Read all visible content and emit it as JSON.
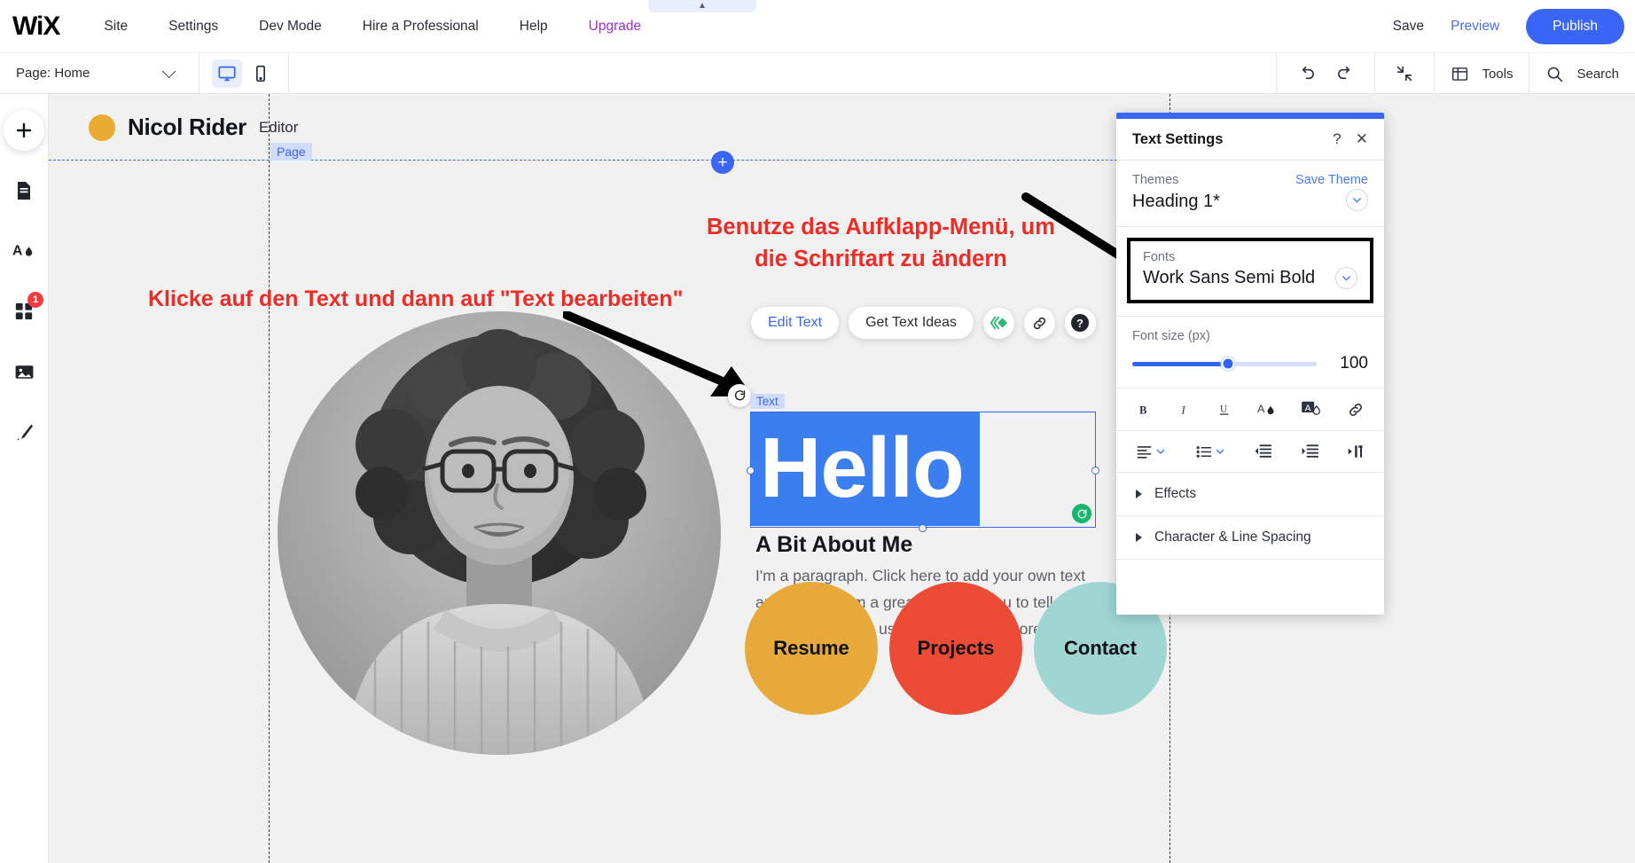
{
  "topbar": {
    "logo": "WiX",
    "nav": [
      {
        "label": "Site"
      },
      {
        "label": "Settings"
      },
      {
        "label": "Dev Mode"
      },
      {
        "label": "Hire a Professional"
      },
      {
        "label": "Help"
      },
      {
        "label": "Upgrade"
      }
    ],
    "save_label": "Save",
    "preview_label": "Preview",
    "publish_label": "Publish"
  },
  "secondbar": {
    "page_label": "Page: Home",
    "desktop_icon": "desktop-icon",
    "mobile_icon": "mobile-icon",
    "undo_icon": "undo-icon",
    "redo_icon": "redo-icon",
    "zoomout_icon": "zoom-out-icon",
    "tools_label": "Tools",
    "search_label": "Search"
  },
  "sidebar": {
    "items": [
      {
        "icon": "plus-icon",
        "name": "add-elements"
      },
      {
        "icon": "page-icon",
        "name": "pages"
      },
      {
        "icon": "theme-icon",
        "name": "site-design"
      },
      {
        "icon": "apps-icon",
        "name": "apps",
        "badge": "1"
      },
      {
        "icon": "media-icon",
        "name": "media"
      },
      {
        "icon": "pen-icon",
        "name": "blog"
      }
    ]
  },
  "canvas": {
    "brand_name": "Nicol Rider",
    "brand_sub": "Editor",
    "page_tag": "Page",
    "text_tag": "Text",
    "hello_text": "Hello",
    "about_title": "A Bit About Me",
    "about_body": "I'm a paragraph. Click here to add your own text and edit me. I’m a great place for you to tell a story and let your users know a little more about you.",
    "circles": [
      {
        "label": "Resume",
        "color": "#e6a93a"
      },
      {
        "label": "Projects",
        "color": "#ec4b36"
      },
      {
        "label": "Contact",
        "color": "#9fd6d4"
      }
    ],
    "edit_toolbar": {
      "edit_text": "Edit Text",
      "get_text_ideas": "Get Text Ideas",
      "animation_icon": "animation-icon",
      "link_icon": "link-icon",
      "help_icon": "help-icon",
      "rotate_icon": "rotate-icon"
    }
  },
  "annotations": {
    "left": "Klicke auf den Text und dann auf \"Text bearbeiten\"",
    "right_line1": "Benutze das Aufklapp-Menü, um",
    "right_line2": "die Schriftart zu ändern",
    "color": "#ef2b25"
  },
  "text_settings": {
    "title": "Text Settings",
    "help_icon": "?",
    "close_icon": "✕",
    "themes_label": "Themes",
    "save_theme_label": "Save Theme",
    "theme_value": "Heading 1*",
    "fonts_label": "Fonts",
    "font_value": "Work Sans Semi Bold",
    "font_size_label": "Font size (px)",
    "font_size_value": "100",
    "format_icons": [
      {
        "name": "bold-icon",
        "glyph": "B"
      },
      {
        "name": "italic-icon",
        "glyph": "I"
      },
      {
        "name": "underline-icon",
        "glyph": "U"
      },
      {
        "name": "text-color-icon",
        "glyph": "A"
      },
      {
        "name": "text-highlight-icon",
        "glyph": "A"
      },
      {
        "name": "link-icon",
        "glyph": "link"
      }
    ],
    "align_icons": [
      {
        "name": "text-align-icon"
      },
      {
        "name": "bullet-list-icon"
      },
      {
        "name": "decrease-indent-icon"
      },
      {
        "name": "increase-indent-icon"
      },
      {
        "name": "text-direction-icon"
      }
    ],
    "effects_label": "Effects",
    "spacing_label": "Character & Line Spacing",
    "accent_color": "#3b66f5"
  }
}
